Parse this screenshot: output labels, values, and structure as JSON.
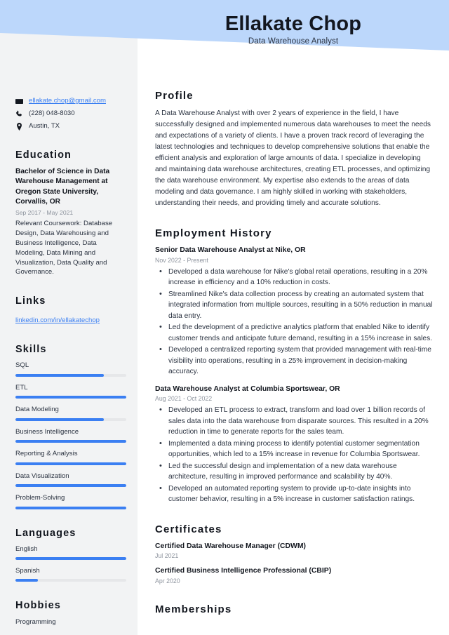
{
  "header": {
    "name": "Ellakate Chop",
    "job_title": "Data Warehouse Analyst",
    "band_color": "#bcd7fb"
  },
  "theme": {
    "sidebar_bg": "#f2f3f4",
    "accent": "#3b7ff2",
    "heading_color": "#13171f",
    "body_color": "#2b3341",
    "muted_color": "#8e949e",
    "track_color": "#e6e7e9"
  },
  "sidebar": {
    "contact": [
      {
        "icon": "envelope-icon",
        "text": "ellakate.chop@gmail.com",
        "is_link": true
      },
      {
        "icon": "phone-icon",
        "text": "(228) 048-8030",
        "is_link": false
      },
      {
        "icon": "location-pin-icon",
        "text": "Austin, TX",
        "is_link": false
      }
    ],
    "education": {
      "heading": "Education",
      "entries": [
        {
          "degree": "Bachelor of Science in Data Warehouse Management at Oregon State University, Corvallis, OR",
          "date": "Sep 2017 - May 2021",
          "description": "Relevant Coursework: Database Design, Data Warehousing and Business Intelligence, Data Modeling, Data Mining and Visualization, Data Quality and Governance."
        }
      ]
    },
    "links": {
      "heading": "Links",
      "items": [
        {
          "label": "linkedin.com/in/ellakatechop"
        }
      ]
    },
    "skills": {
      "heading": "Skills",
      "items": [
        {
          "label": "SQL",
          "level": 80
        },
        {
          "label": "ETL",
          "level": 100
        },
        {
          "label": "Data Modeling",
          "level": 80
        },
        {
          "label": "Business Intelligence",
          "level": 100
        },
        {
          "label": "Reporting & Analysis",
          "level": 100
        },
        {
          "label": "Data Visualization",
          "level": 100
        },
        {
          "label": "Problem-Solving",
          "level": 100
        }
      ]
    },
    "languages": {
      "heading": "Languages",
      "items": [
        {
          "label": "English",
          "level": 100
        },
        {
          "label": "Spanish",
          "level": 20
        }
      ]
    },
    "hobbies": {
      "heading": "Hobbies",
      "items": [
        {
          "label": "Programming"
        }
      ]
    }
  },
  "main": {
    "profile": {
      "heading": "Profile",
      "text": "A Data Warehouse Analyst with over 2 years of experience in the field, I have successfully designed and implemented numerous data warehouses to meet the needs and expectations of a variety of clients. I have a proven track record of leveraging the latest technologies and techniques to develop comprehensive solutions that enable the efficient analysis and exploration of large amounts of data. I specialize in developing and maintaining data warehouse architectures, creating ETL processes, and optimizing the data warehouse environment. My expertise also extends to the areas of data modeling and data governance. I am highly skilled in working with stakeholders, understanding their needs, and providing timely and accurate solutions."
    },
    "employment": {
      "heading": "Employment History",
      "jobs": [
        {
          "title": "Senior Data Warehouse Analyst at Nike, OR",
          "date": "Nov 2022 - Present",
          "bullets": [
            "Developed a data warehouse for Nike's global retail operations, resulting in a 20% increase in efficiency and a 10% reduction in costs.",
            "Streamlined Nike's data collection process by creating an automated system that integrated information from multiple sources, resulting in a 50% reduction in manual data entry.",
            "Led the development of a predictive analytics platform that enabled Nike to identify customer trends and anticipate future demand, resulting in a 15% increase in sales.",
            "Developed a centralized reporting system that provided management with real-time visibility into operations, resulting in a 25% improvement in decision-making accuracy."
          ]
        },
        {
          "title": "Data Warehouse Analyst at Columbia Sportswear, OR",
          "date": "Aug 2021 - Oct 2022",
          "bullets": [
            "Developed an ETL process to extract, transform and load over 1 billion records of sales data into the data warehouse from disparate sources. This resulted in a 20% reduction in time to generate reports for the sales team.",
            "Implemented a data mining process to identify potential customer segmentation opportunities, which led to a 15% increase in revenue for Columbia Sportswear.",
            "Led the successful design and implementation of a new data warehouse architecture, resulting in improved performance and scalability by 40%.",
            "Developed an automated reporting system to provide up-to-date insights into customer behavior, resulting in a 5% increase in customer satisfaction ratings."
          ]
        }
      ]
    },
    "certificates": {
      "heading": "Certificates",
      "items": [
        {
          "title": "Certified Data Warehouse Manager (CDWM)",
          "date": "Jul 2021"
        },
        {
          "title": "Certified Business Intelligence Professional (CBIP)",
          "date": "Apr 2020"
        }
      ]
    },
    "memberships": {
      "heading": "Memberships"
    }
  }
}
